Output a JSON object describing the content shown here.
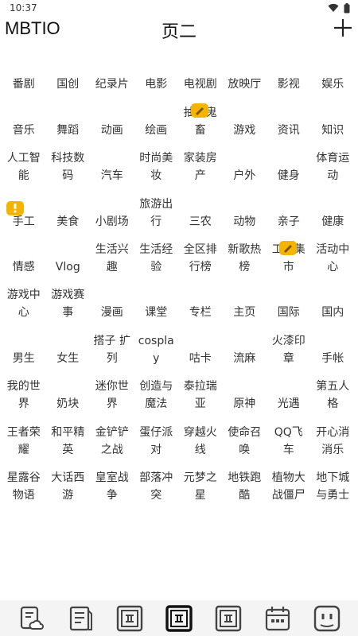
{
  "status_bar": {
    "time": "10:37"
  },
  "header": {
    "app_name": "MBTIO",
    "title": "页二",
    "add_label": "+"
  },
  "grid": [
    "番剧",
    "国创",
    "纪录片",
    "电影",
    "电视剧",
    "放映厅",
    "影视",
    "娱乐",
    "音乐",
    "舞蹈",
    "动画",
    "绘画",
    "抽象鬼畜",
    "游戏",
    "资讯",
    "知识",
    "人工智能",
    "科技数码",
    "汽车",
    "时尚美妆",
    "家装房产",
    "户外",
    "健身",
    "体育运动",
    "手工",
    "美食",
    "小剧场",
    "旅游出行",
    "三农",
    "动物",
    "亲子",
    "健康",
    "情感",
    "Vlog",
    "生活兴趣",
    "生活经验",
    "全区排行榜",
    "新歌热榜",
    "工坊集市",
    "活动中心",
    "游戏中心",
    "游戏赛事",
    "漫画",
    "课堂",
    "专栏",
    "主页",
    "国际",
    "国内",
    "男生",
    "女生",
    "搭子 扩列",
    "cosplay",
    "咕卡",
    "流麻",
    "火漆印章",
    "手帐",
    "我的世界",
    "奶块",
    "迷你世界",
    "创造与魔法",
    "泰拉瑞亚",
    "原神",
    "光遇",
    "第五人格",
    "王者荣耀",
    "和平精英",
    "金铲铲之战",
    "蛋仔派对",
    "穿越火线",
    "使命召唤",
    "QQ飞车",
    "开心消消乐",
    "星露谷物语",
    "大话西游",
    "皇室战争",
    "部落冲突",
    "元梦之星",
    "地铁跑酷",
    "植物大战僵尸",
    "地下城与勇士"
  ],
  "badges": [
    {
      "cell": 12,
      "icon": "note-icon"
    },
    {
      "cell": 24,
      "icon": "exclamation-icon"
    },
    {
      "cell": 38,
      "icon": "note-icon"
    }
  ],
  "bottom_nav": [
    {
      "name": "notes-cloud",
      "icon": "notes-cloud-icon"
    },
    {
      "name": "notebook",
      "icon": "notebook-icon"
    },
    {
      "name": "page-one",
      "icon": "tile-icon"
    },
    {
      "name": "page-two",
      "icon": "tile-icon",
      "active": true
    },
    {
      "name": "page-three",
      "icon": "tile-icon"
    },
    {
      "name": "calendar",
      "icon": "calendar-icon"
    },
    {
      "name": "robot",
      "icon": "robot-face-icon"
    }
  ],
  "colors": {
    "accent_badge": "#f4b400",
    "text": "#333333",
    "nav_bg": "#f4f4f4",
    "icon": "#444444"
  }
}
